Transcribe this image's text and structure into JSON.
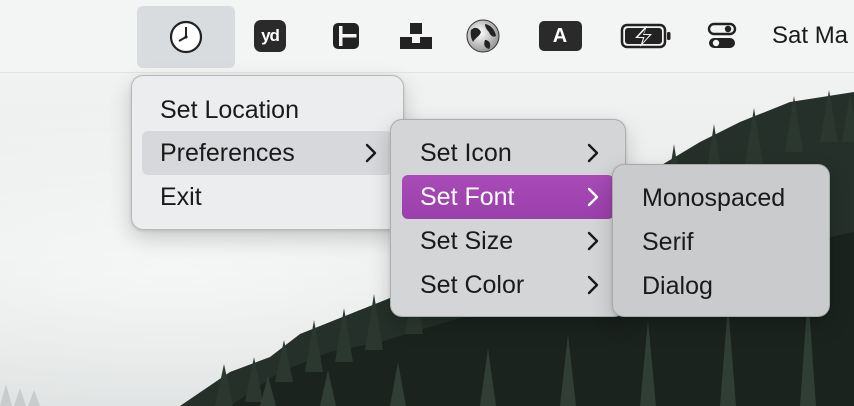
{
  "menubar": {
    "icons": [
      {
        "name": "clock-icon"
      },
      {
        "name": "yd-app-icon",
        "text": "yd"
      },
      {
        "name": "window-layout-icon"
      },
      {
        "name": "stacked-blocks-icon"
      },
      {
        "name": "globe-icon"
      },
      {
        "name": "input-source-icon",
        "text": "A"
      },
      {
        "name": "battery-charging-icon"
      },
      {
        "name": "control-center-icon"
      }
    ],
    "datetime": "Sat Ma"
  },
  "menus": {
    "main": {
      "items": [
        {
          "label": "Set Location",
          "submenu": false
        },
        {
          "label": "Preferences",
          "submenu": true,
          "highlighted": true
        },
        {
          "label": "Exit",
          "submenu": false
        }
      ]
    },
    "preferences": {
      "items": [
        {
          "label": "Set Icon",
          "submenu": true
        },
        {
          "label": "Set Font",
          "submenu": true,
          "selected": true
        },
        {
          "label": "Set Size",
          "submenu": true
        },
        {
          "label": "Set Color",
          "submenu": true
        }
      ]
    },
    "font": {
      "items": [
        {
          "label": "Monospaced"
        },
        {
          "label": "Serif"
        },
        {
          "label": "Dialog"
        }
      ]
    }
  },
  "colors": {
    "selection": "#a244b3",
    "menu_bg": "#ecedee",
    "text": "#1a1a1a"
  }
}
